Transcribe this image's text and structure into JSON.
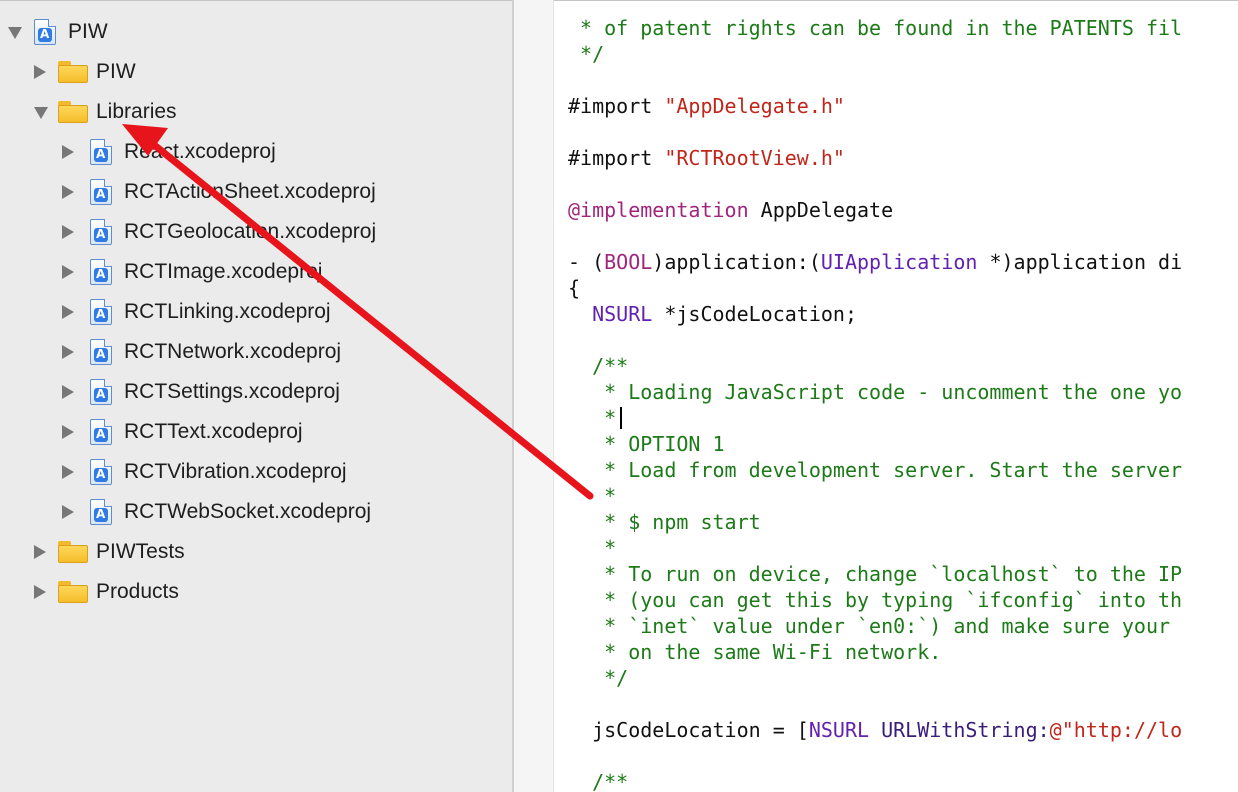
{
  "navigator": {
    "items": [
      {
        "label": "PIW",
        "icon": "xcode-project-icon",
        "expanded": true
      },
      {
        "label": "PIW",
        "icon": "folder-icon",
        "expanded": false
      },
      {
        "label": "Libraries",
        "icon": "folder-icon",
        "expanded": true
      },
      {
        "label": "React.xcodeproj",
        "icon": "xcode-project-icon",
        "expanded": false
      },
      {
        "label": "RCTActionSheet.xcodeproj",
        "icon": "xcode-project-icon",
        "expanded": false
      },
      {
        "label": "RCTGeolocation.xcodeproj",
        "icon": "xcode-project-icon",
        "expanded": false
      },
      {
        "label": "RCTImage.xcodeproj",
        "icon": "xcode-project-icon",
        "expanded": false
      },
      {
        "label": "RCTLinking.xcodeproj",
        "icon": "xcode-project-icon",
        "expanded": false
      },
      {
        "label": "RCTNetwork.xcodeproj",
        "icon": "xcode-project-icon",
        "expanded": false
      },
      {
        "label": "RCTSettings.xcodeproj",
        "icon": "xcode-project-icon",
        "expanded": false
      },
      {
        "label": "RCTText.xcodeproj",
        "icon": "xcode-project-icon",
        "expanded": false
      },
      {
        "label": "RCTVibration.xcodeproj",
        "icon": "xcode-project-icon",
        "expanded": false
      },
      {
        "label": "RCTWebSocket.xcodeproj",
        "icon": "xcode-project-icon",
        "expanded": false
      },
      {
        "label": "PIWTests",
        "icon": "folder-icon",
        "expanded": false
      },
      {
        "label": "Products",
        "icon": "folder-icon",
        "expanded": false
      }
    ]
  },
  "editor": {
    "lines": [
      [
        {
          "t": " * of patent rights can be found in the PATENTS fil",
          "c": "cmt"
        }
      ],
      [
        {
          "t": " */",
          "c": "cmt"
        }
      ],
      [],
      [
        {
          "t": "#import ",
          "c": "plain"
        },
        {
          "t": "\"AppDelegate.h\"",
          "c": "str"
        }
      ],
      [],
      [
        {
          "t": "#import ",
          "c": "plain"
        },
        {
          "t": "\"RCTRootView.h\"",
          "c": "str"
        }
      ],
      [],
      [
        {
          "t": "@implementation",
          "c": "kw"
        },
        {
          "t": " AppDelegate",
          "c": "plain"
        }
      ],
      [],
      [
        {
          "t": "- (",
          "c": "plain"
        },
        {
          "t": "BOOL",
          "c": "kw"
        },
        {
          "t": ")application:(",
          "c": "plain"
        },
        {
          "t": "UIApplication",
          "c": "typ"
        },
        {
          "t": " *)application di",
          "c": "plain"
        }
      ],
      [
        {
          "t": "{",
          "c": "plain"
        }
      ],
      [
        {
          "t": "  ",
          "c": "plain"
        },
        {
          "t": "NSURL",
          "c": "typ"
        },
        {
          "t": " *jsCodeLocation;",
          "c": "plain"
        }
      ],
      [],
      [
        {
          "t": "  /**",
          "c": "cmt"
        }
      ],
      [
        {
          "t": "   * Loading JavaScript code - uncomment the one yo",
          "c": "cmt"
        }
      ],
      [
        {
          "t": "   *",
          "c": "cmt"
        }
      ],
      [
        {
          "t": "   * OPTION 1",
          "c": "cmt"
        }
      ],
      [
        {
          "t": "   * Load from development server. Start the server",
          "c": "cmt"
        }
      ],
      [
        {
          "t": "   *",
          "c": "cmt"
        }
      ],
      [
        {
          "t": "   * $ npm start",
          "c": "cmt"
        }
      ],
      [
        {
          "t": "   *",
          "c": "cmt"
        }
      ],
      [
        {
          "t": "   * To run on device, change `localhost` to the IP",
          "c": "cmt"
        }
      ],
      [
        {
          "t": "   * (you can get this by typing `ifconfig` into th",
          "c": "cmt"
        }
      ],
      [
        {
          "t": "   * `inet` value under `en0:`) and make sure your",
          "c": "cmt"
        }
      ],
      [
        {
          "t": "   * on the same Wi-Fi network.",
          "c": "cmt"
        }
      ],
      [
        {
          "t": "   */",
          "c": "cmt"
        }
      ],
      [],
      [
        {
          "t": "  jsCodeLocation = [",
          "c": "plain"
        },
        {
          "t": "NSURL",
          "c": "typ"
        },
        {
          "t": " URLWithString:",
          "c": "meth"
        },
        {
          "t": "@\"http://lo",
          "c": "str"
        }
      ],
      [],
      [
        {
          "t": "  /**",
          "c": "cmt"
        }
      ]
    ]
  },
  "annotation": {
    "color": "#e8141b",
    "icon": "red-arrow-annotation"
  }
}
